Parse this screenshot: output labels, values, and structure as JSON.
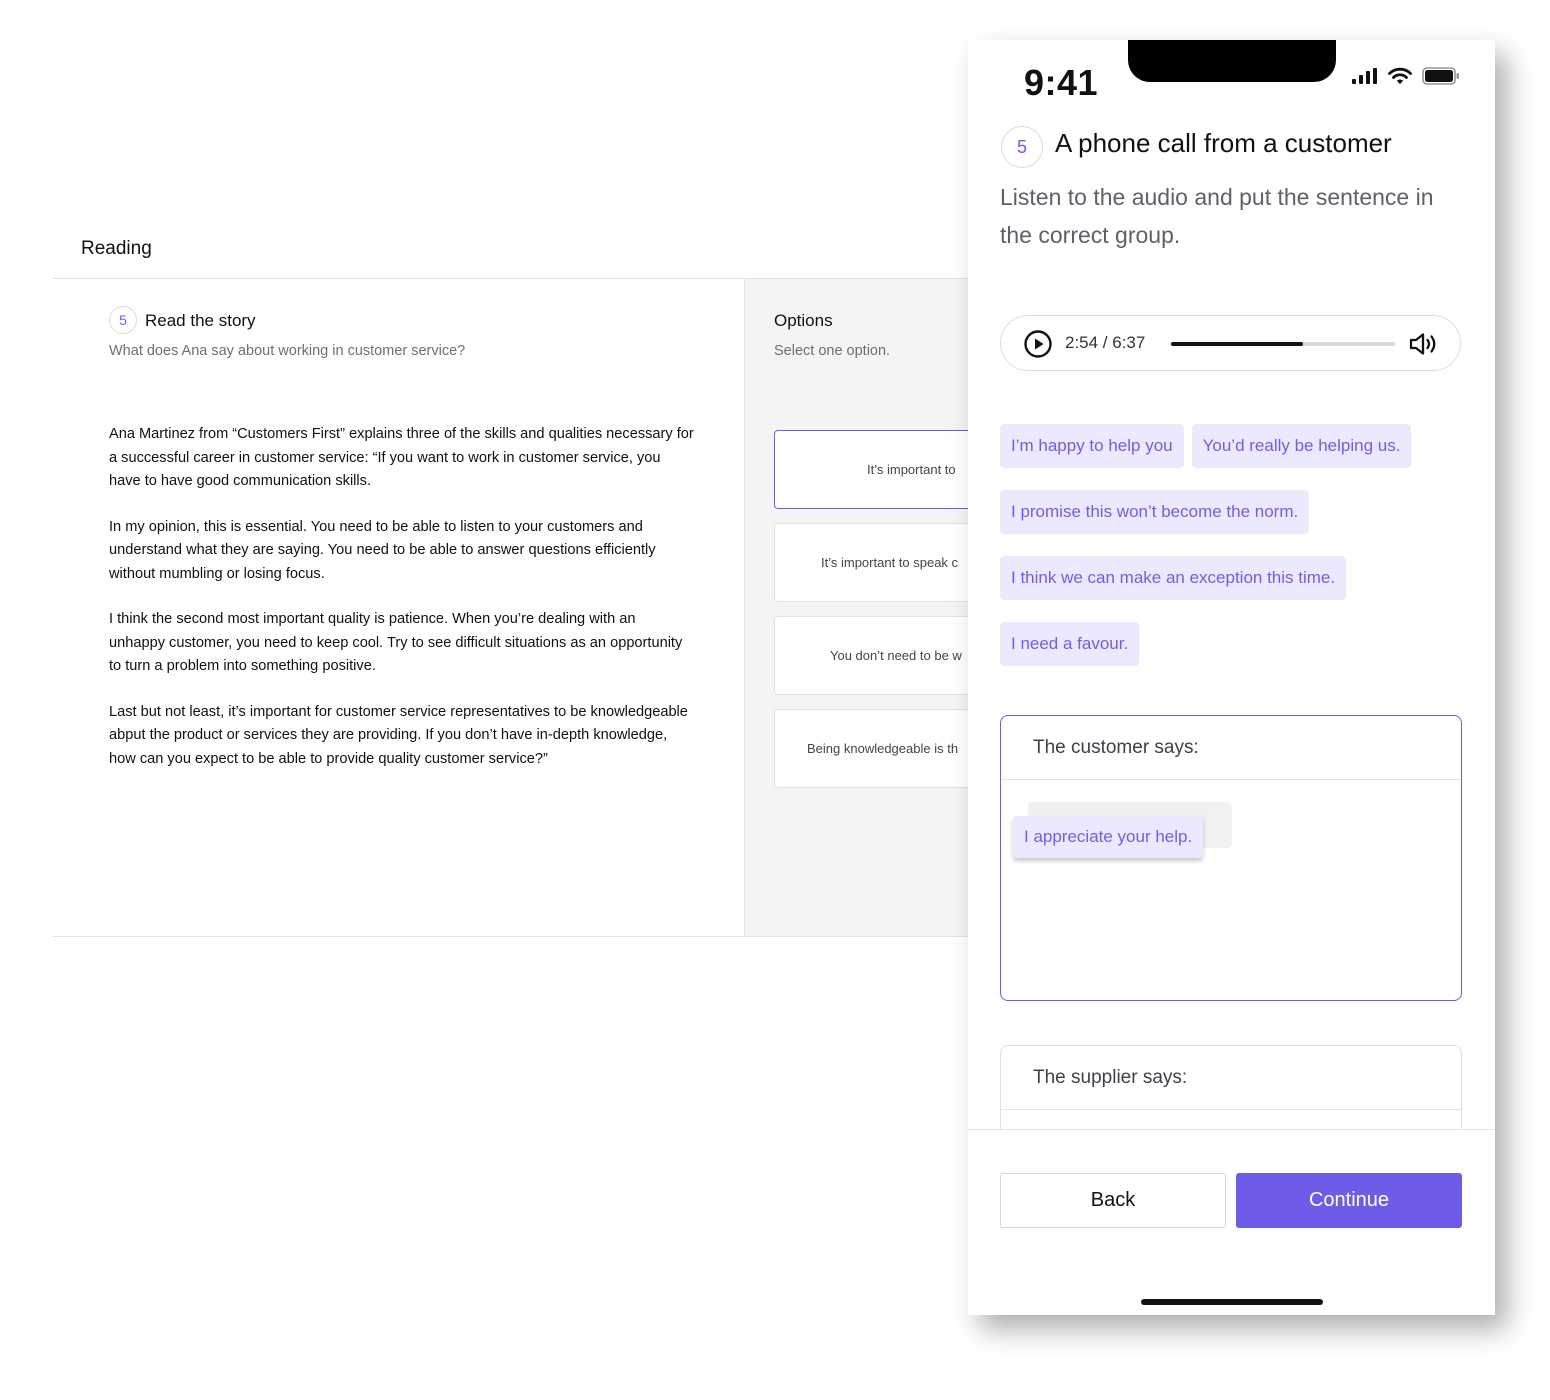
{
  "desktop": {
    "section_title": "Reading",
    "story": {
      "number": "5",
      "title": "Read the story",
      "subtitle": "What does Ana say about working in customer service?",
      "paragraphs": [
        "Ana Martinez from “Customers First” explains three of the skills and qualities necessary for a successful career in customer service: “If you want to work in customer service, you have to have good communication skills.",
        "In my opinion, this is essential. You need to be able to listen to your customers and understand what they are saying. You need to be able to answer questions efficiently without mumbling or losing focus.",
        "I think the second most important quality is patience. When you’re dealing with an unhappy customer, you need to keep cool. Try to see difficult situations as an opportunity to turn a problem into something positive.",
        "Last but not least, it’s important for customer service representatives to be knowledgeable abput the product or services they are providing. If you don’t have in-depth knowledge, how can you expect to be  able to provide quality customer service?”"
      ]
    },
    "options": {
      "title": "Options",
      "subtitle": "Select one option.",
      "items": [
        "It’s important to",
        "It’s important to speak c",
        "You don’t need to be w",
        "Being knowledgeable is th"
      ]
    }
  },
  "phone": {
    "status": {
      "time": "9:41"
    },
    "question": {
      "number": "5",
      "title": "A phone call from a customer",
      "description": "Listen to the audio and put the sentence in the correct group."
    },
    "audio": {
      "time_label": "2:54 / 6:37",
      "progress": 0.59
    },
    "chips": [
      "I’m happy to help you",
      "You’d really be helping us.",
      "I promise this won’t become the norm.",
      "I think we can make an exception this time.",
      "I need a favour."
    ],
    "groups": {
      "customer": {
        "title": "The customer says:",
        "dragged_item": "I appreciate your help."
      },
      "supplier": {
        "title": "The supplier says:"
      }
    },
    "buttons": {
      "back": "Back",
      "continue": "Continue"
    },
    "colors": {
      "accent": "#6c5ce7",
      "chip_bg": "#ece8fd",
      "chip_text": "#7060e0"
    }
  }
}
